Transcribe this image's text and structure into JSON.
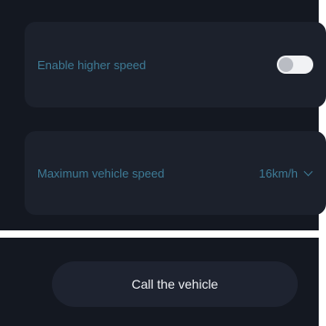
{
  "settings": {
    "higher_speed": {
      "label": "Enable higher speed",
      "toggle_state": "on"
    },
    "max_speed": {
      "label": "Maximum vehicle speed",
      "selected_value": "16km/h"
    }
  },
  "actions": {
    "call_vehicle_label": "Call the vehicle"
  },
  "colors": {
    "background": "#141821",
    "card": "#1c212c",
    "label": "#3e7b96",
    "button_text": "#eef0f4"
  }
}
